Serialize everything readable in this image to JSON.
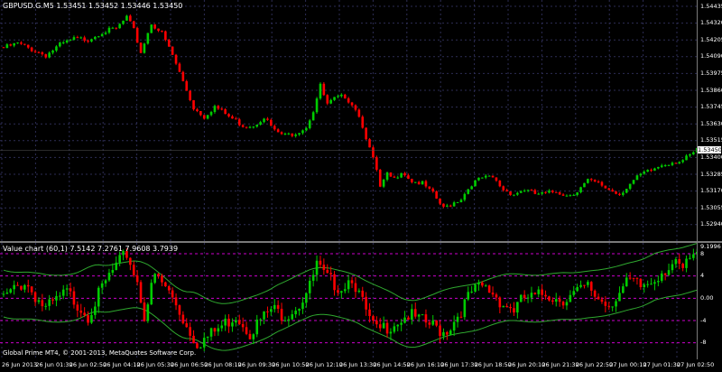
{
  "main_chart": {
    "title": "GBPUSD.G.M5  1.53451 1.53452 1.53446 1.53450",
    "price_ticks": [
      "1.54435",
      "1.54320",
      "1.54205",
      "1.54090",
      "1.53975",
      "1.53860",
      "1.53745",
      "1.53630",
      "1.53515",
      "1.53400",
      "1.53285",
      "1.53170",
      "1.53055",
      "1.52940"
    ],
    "current_price": "1.53450",
    "colors": {
      "bull": "#00cc00",
      "bear": "#ff0000",
      "grid": "#2d2d55",
      "background": "#000000"
    }
  },
  "indicator": {
    "title": "Value chart (60,1) 7.5142 7.2761 7.9608 3.7939",
    "top_value": "9.1996",
    "level_ticks": [
      "8",
      "4",
      "0.00",
      "-4",
      "-8"
    ],
    "colors": {
      "band": "#2fa82f",
      "level": "#cc00cc"
    }
  },
  "footer": {
    "copyright": "Global Prime MT4, © 2001-2013, MetaQuotes Software Corp."
  },
  "time_axis": {
    "labels": [
      "26 Jun 2013",
      "26 Jun 01:30",
      "26 Jun 02:50",
      "26 Jun 04:10",
      "26 Jun 05:30",
      "26 Jun 06:50",
      "26 Jun 08:10",
      "26 Jun 09:30",
      "26 Jun 10:50",
      "26 Jun 12:10",
      "26 Jun 13:30",
      "26 Jun 14:50",
      "26 Jun 16:10",
      "26 Jun 17:30",
      "26 Jun 18:50",
      "26 Jun 20:10",
      "26 Jun 21:30",
      "26 Jun 22:50",
      "27 Jun 00:10",
      "27 Jun 01:30",
      "27 Jun 02:50"
    ]
  },
  "chart_data": {
    "type": "candlestick",
    "symbol": "GBPUSD.G.M5",
    "ohlc_last": {
      "open": 1.53451,
      "high": 1.53452,
      "low": 1.53446,
      "close": 1.5345
    },
    "ylim": [
      1.5288,
      1.5449
    ],
    "close_path": [
      [
        0,
        1.5415
      ],
      [
        4,
        1.5418
      ],
      [
        8,
        1.5414
      ],
      [
        12,
        1.541
      ],
      [
        16,
        1.5417
      ],
      [
        20,
        1.5421
      ],
      [
        24,
        1.5421
      ],
      [
        28,
        1.5426
      ],
      [
        32,
        1.5428
      ],
      [
        35,
        1.5436
      ],
      [
        37,
        1.5427
      ],
      [
        39,
        1.5412
      ],
      [
        42,
        1.5432
      ],
      [
        45,
        1.5425
      ],
      [
        48,
        1.541
      ],
      [
        50,
        1.5398
      ],
      [
        52,
        1.5386
      ],
      [
        54,
        1.5374
      ],
      [
        57,
        1.5368
      ],
      [
        60,
        1.5375
      ],
      [
        64,
        1.5368
      ],
      [
        68,
        1.5362
      ],
      [
        71,
        1.5362
      ],
      [
        74,
        1.5368
      ],
      [
        77,
        1.5358
      ],
      [
        80,
        1.5355
      ],
      [
        83,
        1.5357
      ],
      [
        86,
        1.5361
      ],
      [
        88,
        1.5372
      ],
      [
        90,
        1.5389
      ],
      [
        92,
        1.5376
      ],
      [
        94,
        1.538
      ],
      [
        97,
        1.5382
      ],
      [
        100,
        1.5374
      ],
      [
        102,
        1.5362
      ],
      [
        104,
        1.5346
      ],
      [
        106,
        1.5331
      ],
      [
        107,
        1.5319
      ],
      [
        109,
        1.5328
      ],
      [
        111,
        1.5325
      ],
      [
        113,
        1.5331
      ],
      [
        116,
        1.5324
      ],
      [
        119,
        1.5322
      ],
      [
        122,
        1.5315
      ],
      [
        125,
        1.5305
      ],
      [
        127,
        1.5308
      ],
      [
        130,
        1.5312
      ],
      [
        133,
        1.5322
      ],
      [
        136,
        1.5326
      ],
      [
        139,
        1.5326
      ],
      [
        142,
        1.5318
      ],
      [
        145,
        1.5315
      ],
      [
        148,
        1.5318
      ],
      [
        151,
        1.5315
      ],
      [
        154,
        1.5315
      ],
      [
        157,
        1.5317
      ],
      [
        160,
        1.5314
      ],
      [
        163,
        1.5317
      ],
      [
        166,
        1.5324
      ],
      [
        169,
        1.5322
      ],
      [
        172,
        1.5318
      ],
      [
        175,
        1.5315
      ],
      [
        178,
        1.5322
      ],
      [
        181,
        1.5328
      ],
      [
        184,
        1.5331
      ],
      [
        187,
        1.5335
      ],
      [
        190,
        1.5337
      ],
      [
        193,
        1.5338
      ],
      [
        195,
        1.5341
      ],
      [
        197,
        1.5345
      ]
    ],
    "value_chart_path": [
      [
        0,
        0
      ],
      [
        6,
        3
      ],
      [
        12,
        -2
      ],
      [
        18,
        1
      ],
      [
        24,
        -3
      ],
      [
        30,
        4
      ],
      [
        35,
        8
      ],
      [
        38,
        3
      ],
      [
        40,
        -3
      ],
      [
        43,
        4
      ],
      [
        46,
        2
      ],
      [
        49,
        -1
      ],
      [
        52,
        -5
      ],
      [
        55,
        -8
      ],
      [
        58,
        -7
      ],
      [
        62,
        -5
      ],
      [
        66,
        -3
      ],
      [
        70,
        -6
      ],
      [
        73,
        -4
      ],
      [
        76,
        -2
      ],
      [
        80,
        -3
      ],
      [
        84,
        -1
      ],
      [
        87,
        2
      ],
      [
        89,
        6
      ],
      [
        91,
        4
      ],
      [
        93,
        3
      ],
      [
        96,
        2
      ],
      [
        99,
        4
      ],
      [
        102,
        -1
      ],
      [
        104,
        -4
      ],
      [
        106,
        -6
      ],
      [
        109,
        -5
      ],
      [
        112,
        -4
      ],
      [
        115,
        -3
      ],
      [
        118,
        -4
      ],
      [
        122,
        -5
      ],
      [
        125,
        -6
      ],
      [
        127,
        -5
      ],
      [
        130,
        -2
      ],
      [
        133,
        1
      ],
      [
        136,
        2
      ],
      [
        139,
        1
      ],
      [
        142,
        -1
      ],
      [
        145,
        -2
      ],
      [
        148,
        0
      ],
      [
        151,
        0
      ],
      [
        154,
        1
      ],
      [
        157,
        0
      ],
      [
        160,
        0
      ],
      [
        163,
        1
      ],
      [
        166,
        2
      ],
      [
        169,
        0
      ],
      [
        172,
        -1
      ],
      [
        175,
        1
      ],
      [
        178,
        3
      ],
      [
        181,
        2
      ],
      [
        184,
        3
      ],
      [
        187,
        5
      ],
      [
        190,
        6
      ],
      [
        193,
        5
      ],
      [
        195,
        7
      ],
      [
        197,
        7.5
      ]
    ],
    "indicator_ylim": [
      -10,
      9.3
    ],
    "levels": [
      8,
      4,
      0,
      -4,
      -8
    ]
  }
}
